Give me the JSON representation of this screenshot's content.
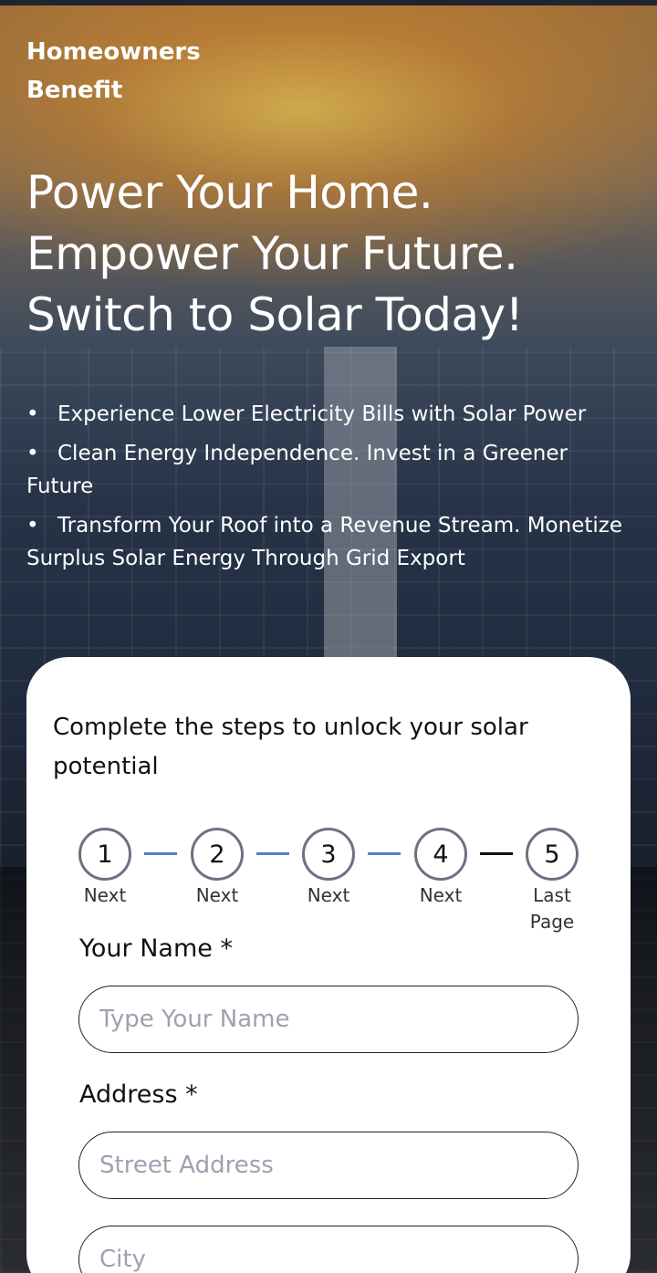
{
  "brand": {
    "line1": "Homeowners",
    "line2": "Benefit"
  },
  "hero": {
    "headline_lines": [
      "Power Your Home.",
      "Empower Your Future.",
      "Switch to Solar Today!"
    ],
    "bullets": [
      "Experience Lower Electricity Bills with Solar Power",
      "Clean Energy Independence. Invest in a Greener Future",
      "Transform Your Roof into a Revenue Stream. Monetize Surplus Solar Energy Through Grid Export"
    ]
  },
  "form": {
    "title": "Complete the steps to unlock your solar potential",
    "steps": [
      {
        "number": "1",
        "label": "Next"
      },
      {
        "number": "2",
        "label": "Next"
      },
      {
        "number": "3",
        "label": "Next"
      },
      {
        "number": "4",
        "label": "Next"
      },
      {
        "number": "5",
        "label": "Last Page"
      }
    ],
    "connector_colors": [
      "#4a7fd4",
      "#4a7fd4",
      "#4a7fd4",
      "#111111"
    ],
    "name_label": "Your Name *",
    "name_placeholder": "Type Your Name",
    "address_label": "Address *",
    "street_placeholder": "Street Address",
    "city_placeholder": "City"
  }
}
